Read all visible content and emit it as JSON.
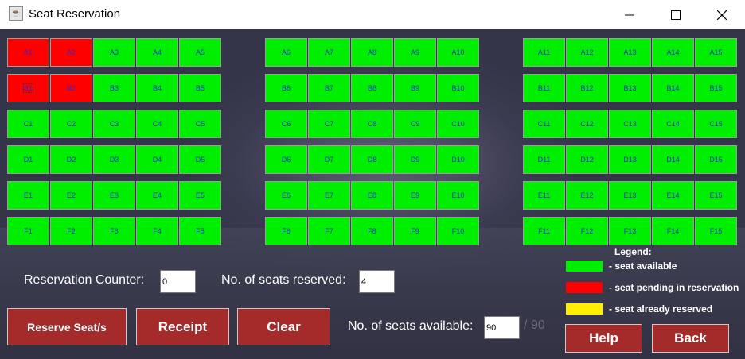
{
  "window": {
    "title": "Seat Reservation"
  },
  "seats": {
    "blocks": [
      {
        "columns": [
          "1",
          "2",
          "3",
          "4",
          "5"
        ]
      },
      {
        "columns": [
          "6",
          "7",
          "8",
          "9",
          "10"
        ]
      },
      {
        "columns": [
          "11",
          "12",
          "13",
          "14",
          "15"
        ]
      }
    ],
    "rows": [
      "A",
      "B",
      "C",
      "D",
      "E",
      "F"
    ],
    "pending": [
      "A1",
      "A2",
      "B1",
      "B2"
    ],
    "reserved": [],
    "focused": "B1"
  },
  "legend": {
    "title": "Legend:",
    "items": [
      {
        "color": "#00ee00",
        "text": "- seat available"
      },
      {
        "color": "#ff0000",
        "text": "- seat pending in reservation"
      },
      {
        "color": "#ffee00",
        "text": "- seat already reserved"
      }
    ]
  },
  "form": {
    "counter_label": "Reservation Counter:",
    "counter_value": "0",
    "reserved_label": "No. of seats reserved:",
    "reserved_value": "4",
    "available_label": "No. of seats available:",
    "available_value": "90",
    "available_total": "/ 90"
  },
  "buttons": {
    "reserve": "Reserve Seat/s",
    "receipt": "Receipt",
    "clear": "Clear",
    "help": "Help",
    "back": "Back"
  }
}
